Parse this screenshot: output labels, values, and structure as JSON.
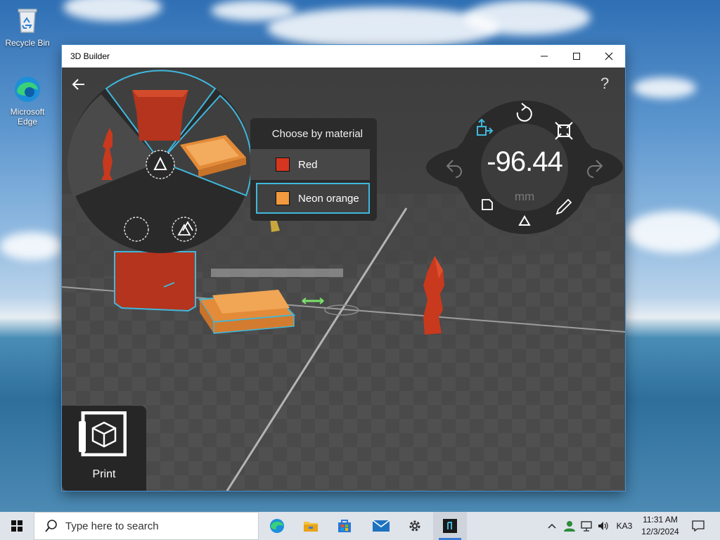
{
  "desktop": {
    "icons": [
      {
        "label": "Recycle Bin",
        "icon": "recycle-bin-icon"
      },
      {
        "label": "Microsoft Edge",
        "icon": "edge-icon"
      }
    ]
  },
  "window": {
    "title": "3D Builder",
    "controls": {
      "minimize": "minimize-icon",
      "maximize": "maximize-icon",
      "close": "close-icon"
    }
  },
  "app": {
    "back_icon": "back-arrow-icon",
    "help_label": "?",
    "material_panel": {
      "header": "Choose by material",
      "items": [
        {
          "label": "Red",
          "color": "#d6361f",
          "selected": false
        },
        {
          "label": "Neon orange",
          "color": "#f29a3d",
          "selected": true
        }
      ]
    },
    "measure": {
      "value": "-96.44",
      "unit": "mm"
    },
    "print": {
      "label": "Print"
    }
  },
  "colors": {
    "accent": "#3fb8de",
    "red_material": "#c0391d",
    "orange_material": "#e38b38",
    "radial_bg": "#2a2a2a"
  },
  "taskbar": {
    "search_placeholder": "Type here to search",
    "apps": [
      "edge-icon",
      "file-explorer-icon",
      "store-icon",
      "mail-icon",
      "settings-icon",
      "3d-builder-icon"
    ],
    "tray": {
      "language": "KA3",
      "time": "11:31 AM",
      "date": "12/3/2024"
    }
  }
}
